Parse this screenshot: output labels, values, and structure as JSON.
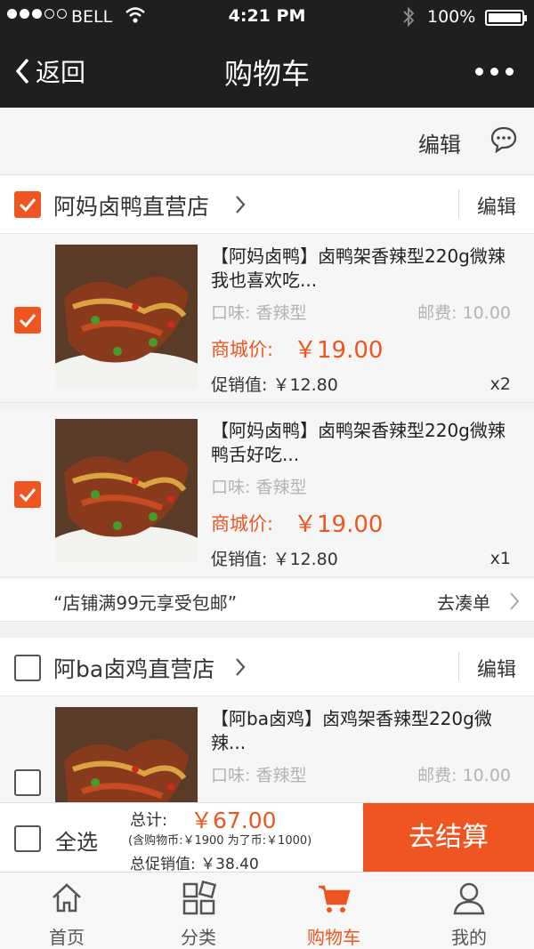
{
  "status_bar": {
    "carrier": "BELL",
    "time": "4:21 PM",
    "battery": "100%"
  },
  "nav": {
    "back_label": "返回",
    "title": "购物车"
  },
  "toolbar": {
    "edit_label": "编辑"
  },
  "stores": [
    {
      "name": "阿妈卤鸭直营店",
      "edit_label": "编辑",
      "checked": true,
      "items": [
        {
          "name": "【阿妈卤鸭】卤鸭架香辣型220g微辣我也喜欢吃...",
          "flavor": "口味: 香辣型",
          "shipping": "邮费: 10.00",
          "price_label": "商城价:",
          "price": "￥19.00",
          "promo": "促销值: ￥12.80",
          "qty": "x2",
          "checked": true
        },
        {
          "name": "【阿妈卤鸭】卤鸭架香辣型220g微辣鸭舌好吃...",
          "flavor": "口味: 香辣型",
          "shipping": "",
          "price_label": "商城价:",
          "price": "￥19.00",
          "promo": "促销值: ￥12.80",
          "qty": "x1",
          "checked": true
        }
      ],
      "free_shipping_msg": "“店铺满99元享受包邮”",
      "go_label": "去凑单"
    },
    {
      "name": "阿ba卤鸡直营店",
      "edit_label": "编辑",
      "checked": false,
      "items": [
        {
          "name": "【阿ba卤鸡】卤鸡架香辣型220g微辣...",
          "flavor": "口味: 香辣型",
          "shipping": "邮费: 10.00",
          "checked": false
        }
      ]
    }
  ],
  "checkout": {
    "select_all_label": "全选",
    "total_label": "总计:",
    "total": "￥67.00",
    "coins_note": "(含购物币:￥1900 为了币:￥1000)",
    "promo_total": "总促销值: ￥38.40",
    "pay_label": "去结算"
  },
  "tabs": [
    {
      "label": "首页",
      "icon": "home-icon"
    },
    {
      "label": "分类",
      "icon": "category-icon"
    },
    {
      "label": "购物车",
      "icon": "cart-icon",
      "active": true
    },
    {
      "label": "我的",
      "icon": "user-icon"
    }
  ],
  "colors": {
    "accent": "#ee5520",
    "nav_bg": "#1f1f1f"
  }
}
